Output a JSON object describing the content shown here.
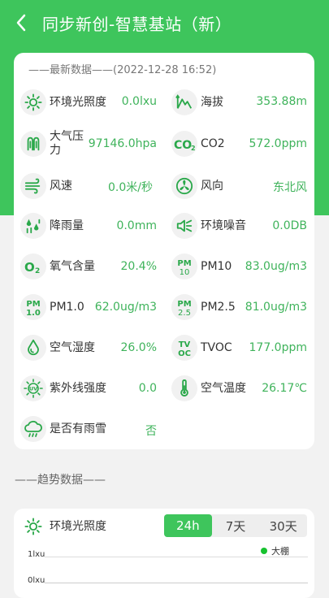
{
  "header": {
    "title": "同步新创-智慧基站（新）"
  },
  "latest": {
    "timestamp": "——最新数据——(2022-12-28 16:52)",
    "items": [
      {
        "label": "环境光照度",
        "value": "0.0lxu",
        "icon": "sun-icon"
      },
      {
        "label": "海拔",
        "value": "353.88m",
        "icon": "altitude-icon"
      },
      {
        "label": "大气压\n力",
        "value": "97146.0hpa",
        "icon": "pressure-icon"
      },
      {
        "label": "CO2",
        "value": "572.0ppm",
        "icon": "co2-icon"
      },
      {
        "label": "风速",
        "value": "0.0米/秒",
        "icon": "wind-icon"
      },
      {
        "label": "风向",
        "value": "东北风",
        "icon": "fan-icon"
      },
      {
        "label": "降雨量",
        "value": "0.0mm",
        "icon": "rain-icon"
      },
      {
        "label": "环境噪音",
        "value": "0.0DB",
        "icon": "speaker-icon"
      },
      {
        "label": "氧气含量",
        "value": "20.4%",
        "icon": "o2-icon"
      },
      {
        "label": "PM10",
        "value": "83.0ug/m3",
        "icon": "pm10-icon"
      },
      {
        "label": "PM1.0",
        "value": "62.0ug/m3",
        "icon": "pm1-icon"
      },
      {
        "label": "PM2.5",
        "value": "81.0ug/m3",
        "icon": "pm25-icon"
      },
      {
        "label": "空气湿度",
        "value": "26.0%",
        "icon": "humidity-icon"
      },
      {
        "label": "TVOC",
        "value": "177.0ppm",
        "icon": "tvoc-icon"
      },
      {
        "label": "紫外线强度",
        "value": "0.0",
        "icon": "uv-icon"
      },
      {
        "label": "空气温度",
        "value": "26.17℃",
        "icon": "thermometer-icon"
      },
      {
        "label": "是否有雨雪",
        "value": "否",
        "icon": "cloud-rain-icon"
      }
    ]
  },
  "trend": {
    "title": "——趋势数据——",
    "metric_label": "环境光照度",
    "tabs": [
      "24h",
      "7天",
      "30天"
    ],
    "active_tab": "24h",
    "legend": "大棚",
    "legend_color": "#17c22f",
    "y_ticks": [
      "1lxu",
      "0lxu"
    ]
  },
  "colors": {
    "accent": "#3ec55c",
    "value": "#3fb35b"
  }
}
